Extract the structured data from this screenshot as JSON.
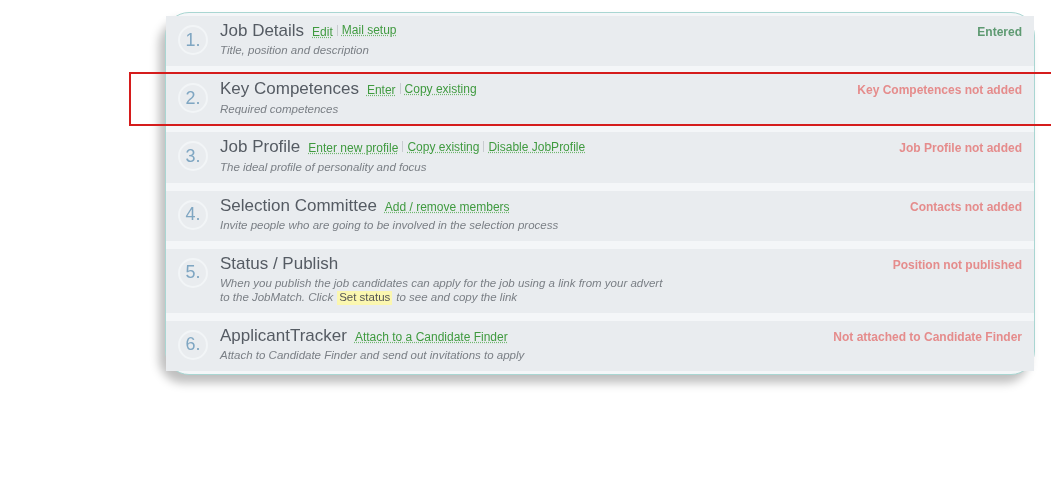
{
  "steps": [
    {
      "number": "1.",
      "title": "Job Details",
      "links": [
        "Edit",
        "Mail setup"
      ],
      "description": [
        [
          {
            "text": "Title, position and description",
            "highlighted": false
          }
        ]
      ],
      "status": "Entered",
      "complete": true,
      "highlighted": false
    },
    {
      "number": "2.",
      "title": "Key Competences",
      "links": [
        "Enter",
        "Copy existing"
      ],
      "description": [
        [
          {
            "text": "Required competences",
            "highlighted": false
          }
        ]
      ],
      "status": "Key Competences not added",
      "complete": false,
      "highlighted": true
    },
    {
      "number": "3.",
      "title": "Job Profile",
      "links": [
        "Enter new profile",
        "Copy existing",
        "Disable JobProfile"
      ],
      "description": [
        [
          {
            "text": "The ideal profile of personality and focus",
            "highlighted": false
          }
        ]
      ],
      "status": "Job Profile not added",
      "complete": false,
      "highlighted": false
    },
    {
      "number": "4.",
      "title": "Selection Committee",
      "links": [
        "Add / remove members"
      ],
      "description": [
        [
          {
            "text": "Invite people who are going to be involved in the selection process",
            "highlighted": false
          }
        ]
      ],
      "status": "Contacts not added",
      "complete": false,
      "highlighted": false
    },
    {
      "number": "5.",
      "title": "Status / Publish",
      "description": [
        [
          {
            "text": "When you publish the job candidates can apply for the job using a link from your advert",
            "highlighted": false
          }
        ],
        [
          {
            "text": "to the JobMatch. Click",
            "highlighted": false
          },
          {
            "text": "Set status",
            "highlighted": true
          },
          {
            "text": "to see and copy the link",
            "highlighted": false
          }
        ]
      ],
      "status": "Position not published",
      "complete": false,
      "highlighted": false
    },
    {
      "number": "6.",
      "title": "ApplicantTracker",
      "links": [
        "Attach to a Candidate Finder"
      ],
      "description": [
        [
          {
            "text": "Attach to Candidate Finder and send out invitations to apply",
            "highlighted": false
          }
        ]
      ],
      "status": "Not attached to Candidate Finder",
      "complete": false,
      "highlighted": false
    }
  ]
}
